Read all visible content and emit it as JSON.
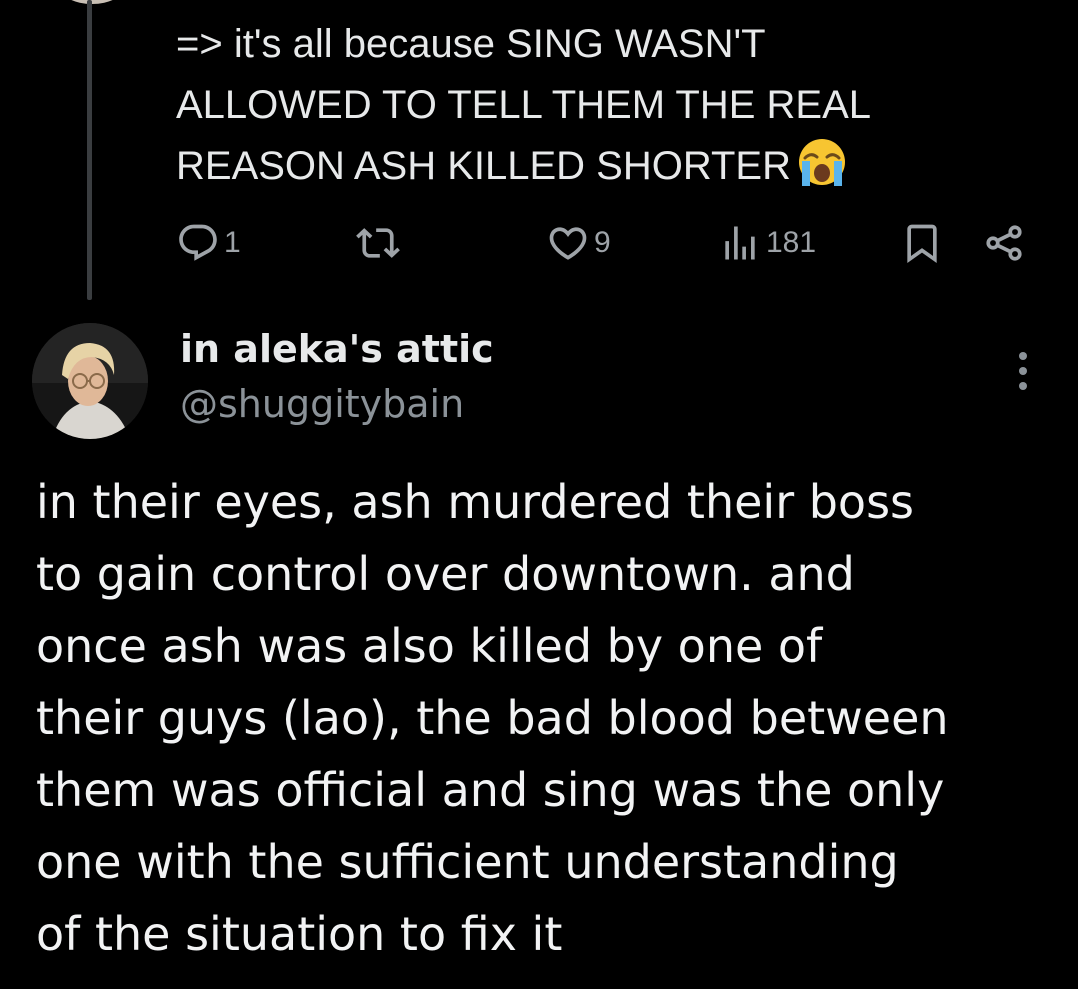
{
  "previous_tweet": {
    "text": "=> it's all because SING WASN'T\nALLOWED TO TELL THEM THE REAL\nREASON ASH KILLED SHORTER",
    "emoji": "crying-face",
    "actions": {
      "reply_count": "1",
      "retweet_count": "",
      "like_count": "9",
      "views_count": "181"
    }
  },
  "tweet": {
    "author_name": "in aleka's attic",
    "author_handle": "@shuggitybain",
    "text": "in their eyes, ash murdered their boss\nto gain control over downtown. and\nonce ash was also killed by one of\ntheir guys (lao), the bad blood between\nthem was official and sing was the only\none with the sufficient understanding\nof the situation to fix it"
  },
  "colors": {
    "background": "#000000",
    "text_primary": "#e7e9ea",
    "text_secondary": "#8b9298",
    "icon": "#9ea3a8",
    "thread_line": "#3a3d40"
  },
  "icons": [
    "reply-icon",
    "retweet-icon",
    "like-icon",
    "views-icon",
    "bookmark-icon",
    "share-icon",
    "more-icon"
  ]
}
